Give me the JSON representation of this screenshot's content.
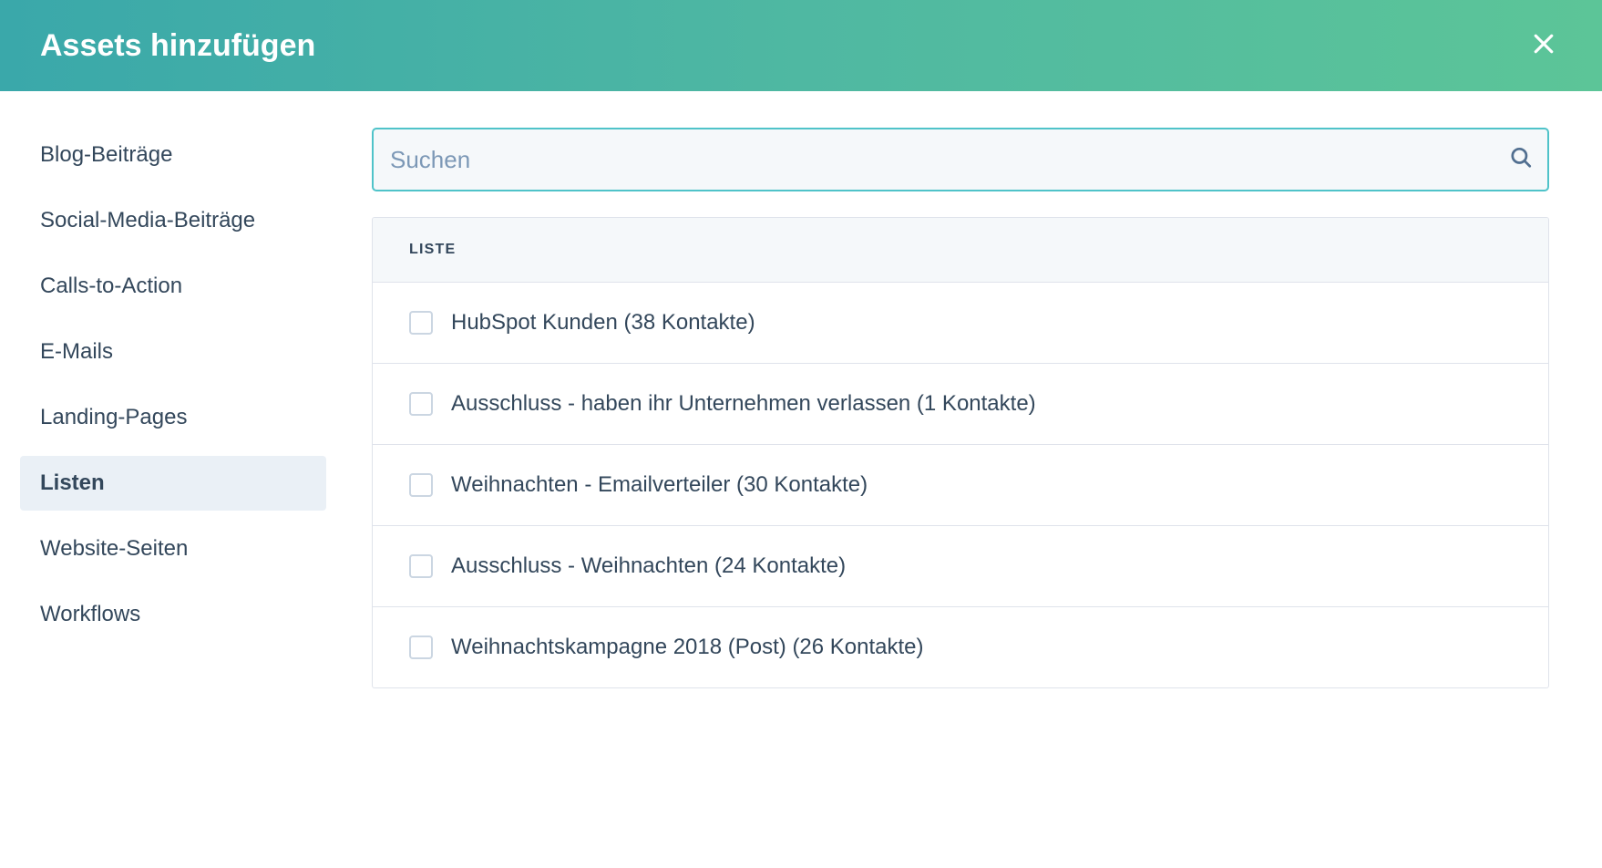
{
  "header": {
    "title": "Assets hinzufügen"
  },
  "sidebar": {
    "items": [
      {
        "label": "Blog-Beiträge",
        "active": false
      },
      {
        "label": "Social-Media-Beiträge",
        "active": false
      },
      {
        "label": "Calls-to-Action",
        "active": false
      },
      {
        "label": "E-Mails",
        "active": false
      },
      {
        "label": "Landing-Pages",
        "active": false
      },
      {
        "label": "Listen",
        "active": true
      },
      {
        "label": "Website-Seiten",
        "active": false
      },
      {
        "label": "Workflows",
        "active": false
      }
    ]
  },
  "search": {
    "placeholder": "Suchen",
    "value": ""
  },
  "table": {
    "header_label": "LISTE",
    "rows": [
      {
        "label": "HubSpot Kunden (38 Kontakte)"
      },
      {
        "label": "Ausschluss - haben ihr Unternehmen verlassen (1 Kontakte)"
      },
      {
        "label": "Weihnachten - Emailverteiler (30 Kontakte)"
      },
      {
        "label": "Ausschluss - Weihnachten (24 Kontakte)"
      },
      {
        "label": "Weihnachtskampagne 2018 (Post) (26 Kontakte)"
      }
    ]
  }
}
